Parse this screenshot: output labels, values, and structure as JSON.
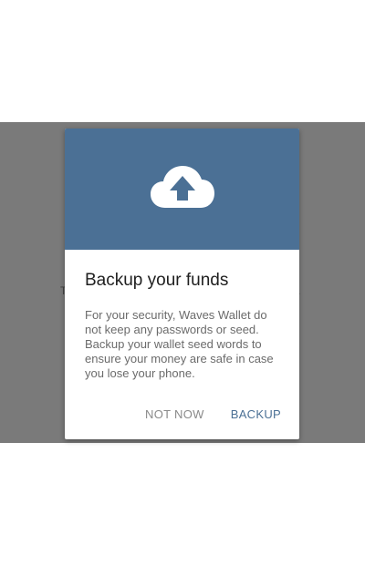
{
  "background": {
    "left_text": "T",
    "right_text": "."
  },
  "dialog": {
    "icon": "cloud-upload-icon",
    "title": "Backup your funds",
    "message": "For your security, Waves Wallet do not keep any passwords or seed. Backup your wallet seed words to ensure your money are safe in case you lose your phone.",
    "not_now_label": "NOT NOW",
    "backup_label": "BACKUP"
  },
  "colors": {
    "header": "#4b7095",
    "accent": "#4b7095",
    "scrim": "#7a7a7a"
  }
}
